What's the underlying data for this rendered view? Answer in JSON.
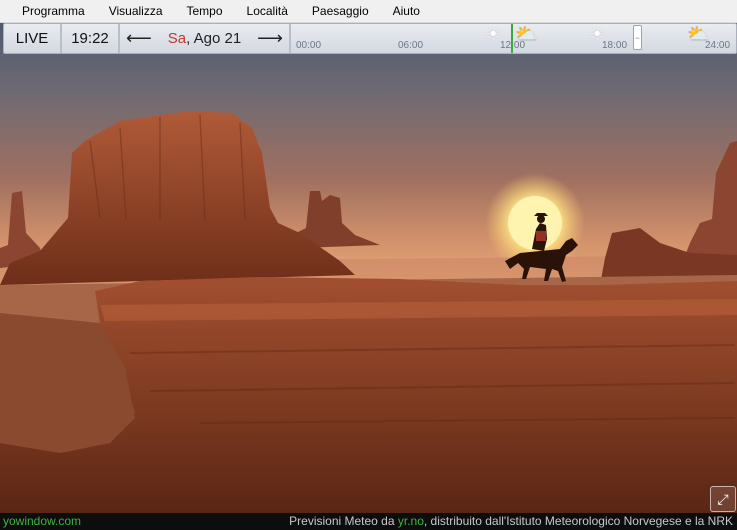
{
  "menu": [
    "Programma",
    "Visualizza",
    "Tempo",
    "Località",
    "Paesaggio",
    "Aiuto"
  ],
  "timebar": {
    "live_label": "LIVE",
    "time": "19:22",
    "prev_icon": "arrow-left-icon",
    "next_icon": "arrow-right-icon",
    "day": "Sa",
    "date_rest": ", Ago 21",
    "ticks": [
      "00:00",
      "06:00",
      "12:00",
      "18:00",
      "24:00"
    ],
    "now_color": "#3da63d"
  },
  "weather_icons": [
    "sun-icon",
    "partly-cloudy-icon",
    "sun-icon",
    "partly-cloudy-icon"
  ],
  "footer": {
    "brand": "yowindow.com",
    "credit_pre": "Previsioni Meteo da ",
    "credit_link": "yr.no",
    "credit_post": ", distribuito dall'Istituto Meteorologico Norvegese e la NRK"
  },
  "colors": {
    "accent": "#3fb33f",
    "day_highlight": "#c0392b"
  }
}
